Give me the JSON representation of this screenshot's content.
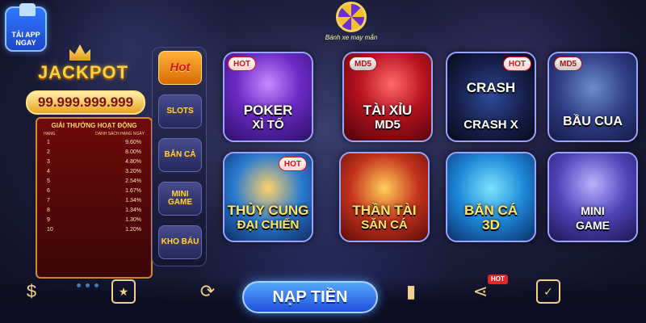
{
  "app_download": {
    "line1": "TẢI APP",
    "line2": "NGAY"
  },
  "lucky_wheel": {
    "label": "Bánh xe may mắn"
  },
  "jackpot": {
    "title": "JACKPOT",
    "amount": "99.999.999.999",
    "table_title": "GIẢI THƯỞNG HOẠT ĐỘNG",
    "col_rank": "HẠNG",
    "col_list": "DANH SÁCH HẠNG NGÀY",
    "rows": [
      {
        "rank": "1",
        "value": "9.60%"
      },
      {
        "rank": "2",
        "value": "8.00%"
      },
      {
        "rank": "3",
        "value": "4.80%"
      },
      {
        "rank": "4",
        "value": "3.20%"
      },
      {
        "rank": "5",
        "value": "2.54%"
      },
      {
        "rank": "6",
        "value": "1.67%"
      },
      {
        "rank": "7",
        "value": "1.34%"
      },
      {
        "rank": "8",
        "value": "1.34%"
      },
      {
        "rank": "9",
        "value": "1.30%"
      },
      {
        "rank": "10",
        "value": "1.20%"
      }
    ]
  },
  "side_menu": {
    "hot": "Hot",
    "slots": "SLOTS",
    "ban_ca": "BẮN CÁ",
    "mini_game": "MINI GAME",
    "kho_bau": "KHO BÁU"
  },
  "games": [
    {
      "l1": "POKER",
      "l2": "XÌ TỐ",
      "badge": "HOT"
    },
    {
      "l1": "TÀI XỈU",
      "l2": "MD5",
      "badge": "MD5"
    },
    {
      "l1": "CRASH",
      "l2": "CRASH X",
      "badge": "HOT"
    },
    {
      "l1": "BẦU CUA",
      "l2": "",
      "badge": "MD5"
    },
    {
      "l1": "THỦY CUNG",
      "l2": "ĐẠI CHIẾN",
      "badge": "HOT"
    },
    {
      "l1": "THẦN TÀI",
      "l2": "SĂN CÁ",
      "badge": ""
    },
    {
      "l1": "BẮN CÁ",
      "l2": "3D",
      "badge": ""
    },
    {
      "l1": "MINI",
      "l2": "GAME",
      "badge": ""
    }
  ],
  "bottom_bar": {
    "deposit_label": "NẠP TIỀN",
    "share_badge": "HOT"
  },
  "colors": {
    "gold": "#ffd23a",
    "deposit_blue": "#1d4fd9",
    "hot_red": "#d11111"
  }
}
